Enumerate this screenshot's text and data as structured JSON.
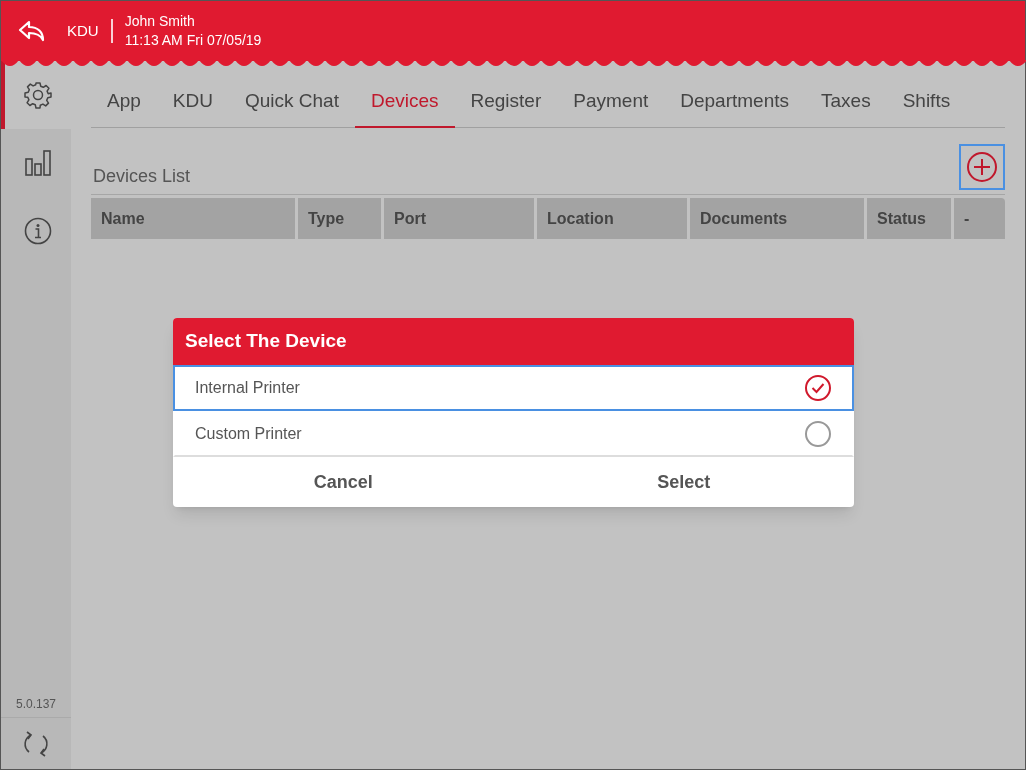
{
  "header": {
    "station": "KDU",
    "user": "John  Smith",
    "datetime": "11:13 AM Fri 07/05/19"
  },
  "sidebar": {
    "items": [
      {
        "kind": "settings",
        "selected": true
      },
      {
        "kind": "reports",
        "selected": false
      },
      {
        "kind": "info",
        "selected": false
      }
    ],
    "version": "5.0.137"
  },
  "tabs": [
    {
      "label": "App",
      "selected": false
    },
    {
      "label": "KDU",
      "selected": false
    },
    {
      "label": "Quick Chat",
      "selected": false
    },
    {
      "label": "Devices",
      "selected": true
    },
    {
      "label": "Register",
      "selected": false
    },
    {
      "label": "Payment",
      "selected": false
    },
    {
      "label": "Departments",
      "selected": false
    },
    {
      "label": "Taxes",
      "selected": false
    },
    {
      "label": "Shifts",
      "selected": false
    }
  ],
  "devices_list": {
    "title": "Devices List",
    "columns": [
      "Name",
      "Type",
      "Port",
      "Location",
      "Documents",
      "Status",
      "-"
    ]
  },
  "dialog": {
    "title": "Select The Device",
    "options": [
      {
        "label": "Internal Printer",
        "selected": true
      },
      {
        "label": "Custom Printer",
        "selected": false
      }
    ],
    "buttons": [
      "Cancel",
      "Select"
    ]
  }
}
